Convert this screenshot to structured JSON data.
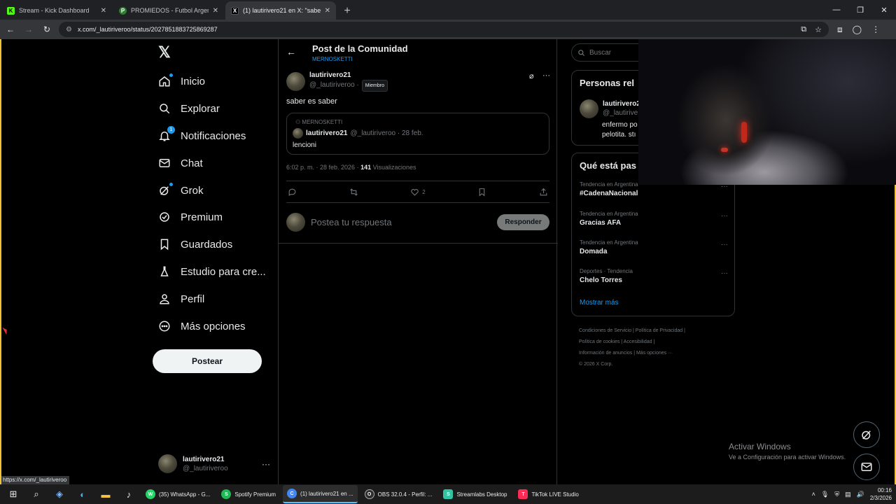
{
  "browser": {
    "tabs": [
      {
        "title": "Stream - Kick Dashboard",
        "favicon": "K",
        "color": "#53fc18",
        "active": false
      },
      {
        "title": "PROMIEDOS - Futbol Argentino",
        "favicon": "P",
        "color": "#2e7d32",
        "active": false
      },
      {
        "title": "(1) lautirivero21 en X: \"saber es",
        "favicon": "X",
        "color": "#000000",
        "active": true
      }
    ],
    "url": "x.com/_lautiriveroo/status/2027851883725869287",
    "status_url": "https://x.com/_lautiriveroo"
  },
  "nav": {
    "items": [
      {
        "label": "Inicio",
        "icon": "home-icon"
      },
      {
        "label": "Explorar",
        "icon": "search-icon"
      },
      {
        "label": "Notificaciones",
        "icon": "bell-icon",
        "badge": "1"
      },
      {
        "label": "Chat",
        "icon": "mail-icon"
      },
      {
        "label": "Grok",
        "icon": "grok-icon"
      },
      {
        "label": "Premium",
        "icon": "verified-icon"
      },
      {
        "label": "Guardados",
        "icon": "bookmark-icon"
      },
      {
        "label": "Estudio para cre...",
        "icon": "flask-icon"
      },
      {
        "label": "Perfil",
        "icon": "person-icon"
      },
      {
        "label": "Más opciones",
        "icon": "more-circle-icon"
      }
    ],
    "post_label": "Postear",
    "account": {
      "name": "lautirivero21",
      "handle": "@_lautiriveroo"
    }
  },
  "post": {
    "header_title": "Post de la Comunidad",
    "header_sub": "MERNOSKETTI",
    "author": {
      "name": "lautirivero21",
      "handle": "@_lautiriveroo ·",
      "badge": "Miembro"
    },
    "text": "saber es saber",
    "quote": {
      "community": "MERNOSKETTI",
      "name": "lautirivero21",
      "meta": "@_lautiriveroo · 28 feb.",
      "text": "lencioni"
    },
    "time": "6:02 p. m. · 28 feb. 2026 ·",
    "views_count": "141",
    "views_label": "Visualizaciones",
    "likes": "2",
    "reply_placeholder": "Postea tu respuesta",
    "reply_button": "Responder"
  },
  "sidebar": {
    "search_placeholder": "Buscar",
    "related_title": "Personas rel",
    "related_user": {
      "name": "lautirivero2",
      "handle": "@_lautirive",
      "bio_line1": "enfermo po",
      "bio_line2": "pelotita. stı"
    },
    "trends_title": "Qué está pas",
    "trends": [
      {
        "category": "Tendencia en Argentina",
        "title": "#CadenaNacional"
      },
      {
        "category": "Tendencia en Argentina",
        "title": "Gracias AFA"
      },
      {
        "category": "Tendencia en Argentina",
        "title": "Domada"
      },
      {
        "category": "Deportes · Tendencia",
        "title": "Chelo Torres"
      }
    ],
    "show_more": "Mostrar más",
    "footer_line1": "Condiciones de Servicio  |  Política de Privacidad  |",
    "footer_line2": "Política de cookies  |  Accesibilidad  |",
    "footer_line3": "Información de anuncios  |  Más opciones ···",
    "footer_line4": "© 2026 X Corp."
  },
  "watermark": {
    "title": "Activar Windows",
    "sub": "Ve a Configuración para activar Windows."
  },
  "taskbar": {
    "apps": [
      {
        "label": "(35) WhatsApp - G...",
        "color": "#25d366",
        "glyph": "W",
        "active": false
      },
      {
        "label": "Spotify Premium",
        "color": "#1db954",
        "glyph": "S",
        "active": false
      },
      {
        "label": "(1) lautirivero21 en ...",
        "color": "#4285f4",
        "glyph": "C",
        "active": true
      },
      {
        "label": "OBS 32.0.4 - Perfil: ...",
        "color": "#302e31",
        "glyph": "O",
        "active": false
      },
      {
        "label": "Streamlabs Desktop",
        "color": "#31c3a2",
        "glyph": "S",
        "active": false
      },
      {
        "label": "TikTok LIVE Studio",
        "color": "#fe2c55",
        "glyph": "T",
        "active": false
      }
    ],
    "time": "00:16",
    "date": "2/3/2026"
  }
}
